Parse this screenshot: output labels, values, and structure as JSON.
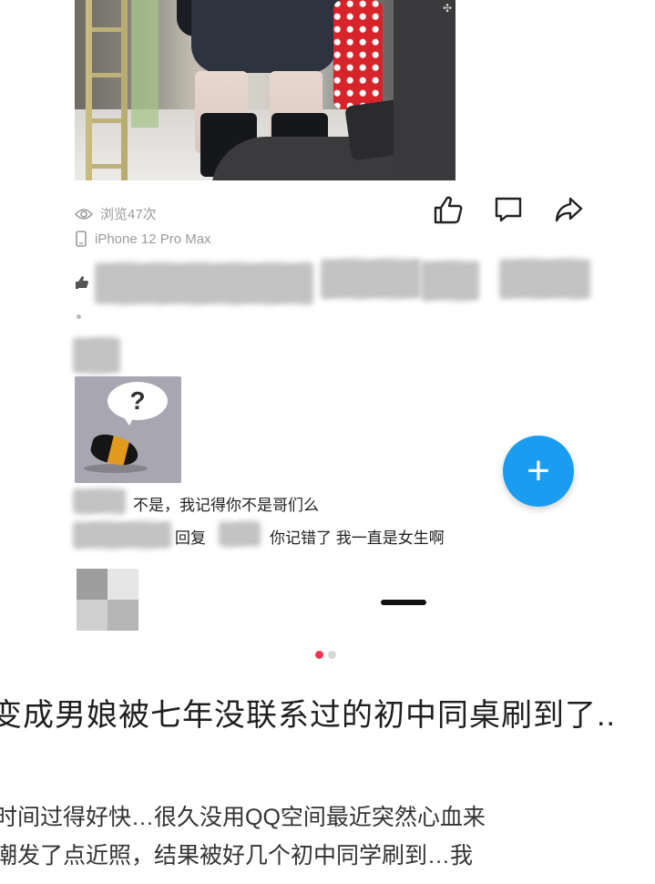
{
  "post": {
    "views": "浏览47次",
    "device": "iPhone 12 Pro Max",
    "watermark": "✣"
  },
  "actions": [
    {
      "name": "like",
      "icon": "thumbs-up-icon"
    },
    {
      "name": "comment",
      "icon": "comment-icon"
    },
    {
      "name": "share",
      "icon": "share-icon"
    }
  ],
  "comments": {
    "reply1_text": "不是，我记得你不是哥们么",
    "reply2_prefix": "回复",
    "reply2_text": "你记错了 我一直是女生啊",
    "sticker_glyph": "?"
  },
  "fab": {
    "label": "+"
  },
  "pager": {
    "total": 2,
    "active": 1
  },
  "article": {
    "title": "变成男娘被七年没联系过的初中同桌刷到了..",
    "body_lines": [
      "时间过得好快…很久没用QQ空间最近突然心血来",
      "潮发了点近照，结果被好几个初中同学刷到…我"
    ]
  },
  "colors": {
    "accent_blue": "#1a9df0",
    "pager_active": "#f2354f",
    "meta_gray": "#9a9a9a"
  }
}
